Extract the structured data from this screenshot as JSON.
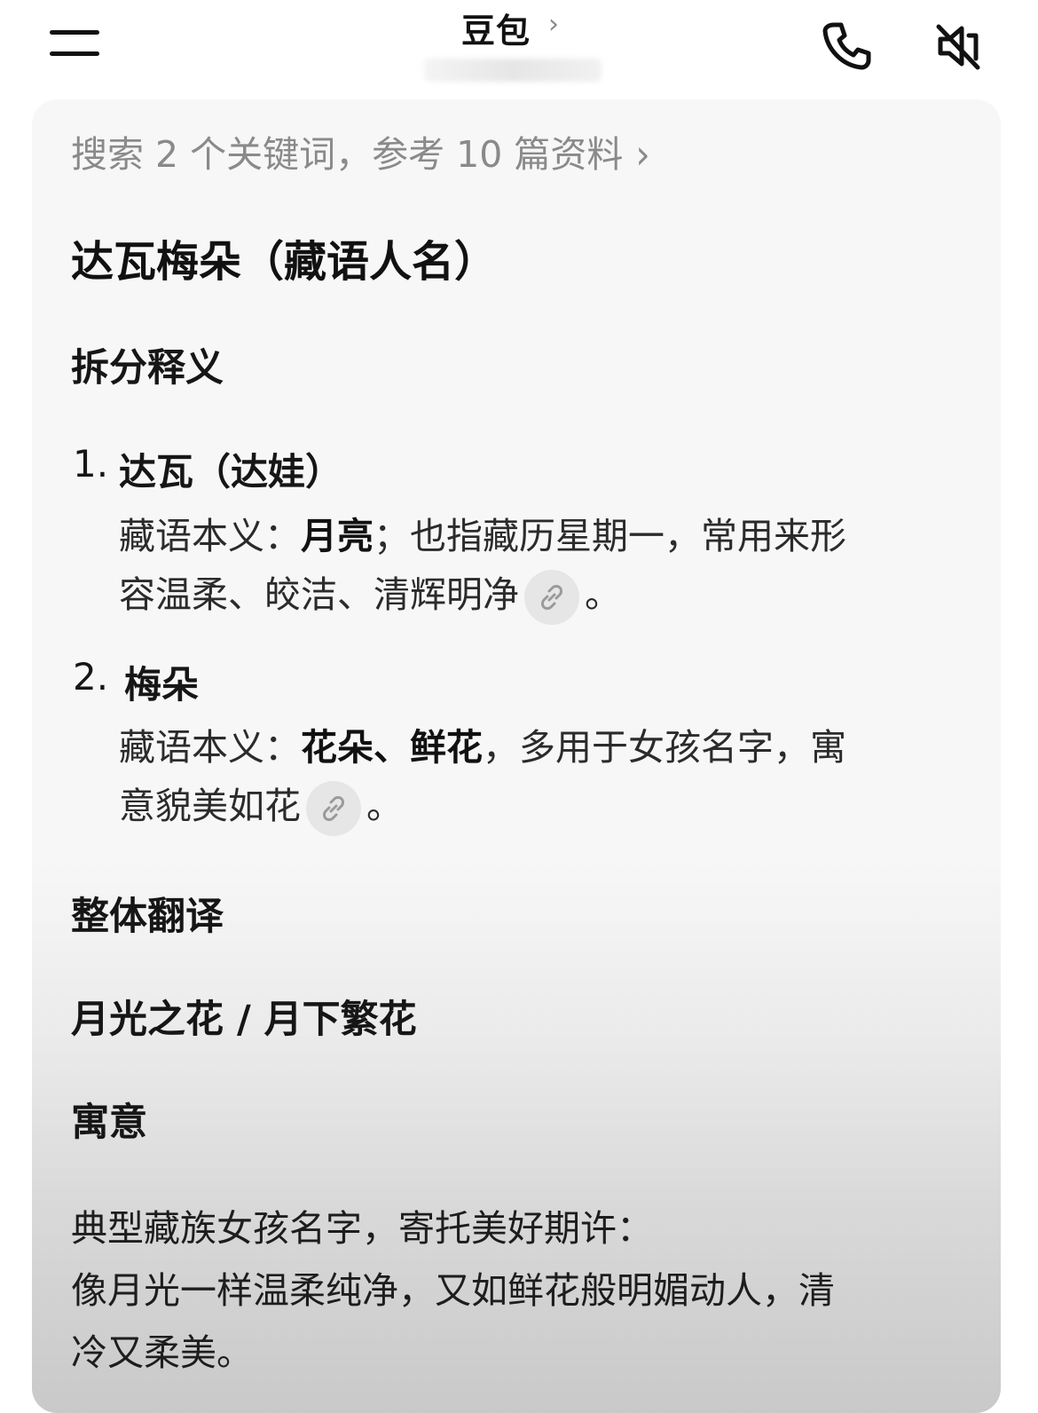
{
  "header": {
    "title": "豆包",
    "title_chevron": "›",
    "menu_icon": "hamburger-icon",
    "call_icon": "phone-icon",
    "mute_icon": "speaker-muted-icon"
  },
  "search_summary": {
    "text": "搜索 2 个关键词，参考 10 篇资料",
    "chevron": "›"
  },
  "answer": {
    "title": "达瓦梅朵（藏语人名）",
    "section1_title": "拆分释义",
    "items": [
      {
        "num": "1.",
        "head": "达瓦（达娃）",
        "line1_pre": "藏语本义：",
        "line1_bold": "月亮",
        "line1_post": "；也指藏历星期一，常用来形",
        "line2": "容温柔、皎洁、清辉明净",
        "line2_end": "。"
      },
      {
        "num": "2.",
        "head": "梅朵",
        "line1_pre": "藏语本义：",
        "line1_bold": "花朵、鲜花",
        "line1_post": "，多用于女孩名字，寓",
        "line2": "意貌美如花",
        "line2_end": "。"
      }
    ],
    "section2_title": "整体翻译",
    "translation": "月光之花 / 月下繁花",
    "section3_title": "寓意",
    "meaning_lines": [
      "典型藏族女孩名字，寄托美好期许：",
      "像月光一样温柔纯净，又如鲜花般明媚动人，清",
      "冷又柔美。"
    ]
  },
  "colors": {
    "card_bg": "#f7f7f7",
    "muted_text": "#8a8a8a",
    "cite_bg": "#e6e6e6"
  }
}
